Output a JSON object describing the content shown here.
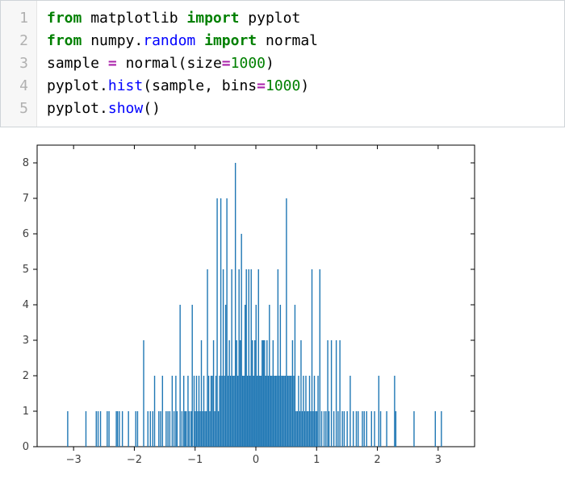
{
  "code": {
    "line_numbers": [
      "1",
      "2",
      "3",
      "4",
      "5"
    ],
    "lines": [
      [
        {
          "cls": "keyword",
          "t": "from"
        },
        {
          "cls": "plain",
          "t": " "
        },
        {
          "cls": "module",
          "t": "matplotlib"
        },
        {
          "cls": "plain",
          "t": " "
        },
        {
          "cls": "keyword",
          "t": "import"
        },
        {
          "cls": "plain",
          "t": " "
        },
        {
          "cls": "module",
          "t": "pyplot"
        }
      ],
      [
        {
          "cls": "keyword",
          "t": "from"
        },
        {
          "cls": "plain",
          "t": " "
        },
        {
          "cls": "module",
          "t": "numpy"
        },
        {
          "cls": "punct",
          "t": "."
        },
        {
          "cls": "func",
          "t": "random"
        },
        {
          "cls": "plain",
          "t": " "
        },
        {
          "cls": "keyword",
          "t": "import"
        },
        {
          "cls": "plain",
          "t": " "
        },
        {
          "cls": "module",
          "t": "normal"
        }
      ],
      [
        {
          "cls": "identifier",
          "t": "sample"
        },
        {
          "cls": "plain",
          "t": " "
        },
        {
          "cls": "operator",
          "t": "="
        },
        {
          "cls": "plain",
          "t": " "
        },
        {
          "cls": "identifier",
          "t": "normal"
        },
        {
          "cls": "punct",
          "t": "("
        },
        {
          "cls": "identifier",
          "t": "size"
        },
        {
          "cls": "operator",
          "t": "="
        },
        {
          "cls": "number",
          "t": "1000"
        },
        {
          "cls": "punct",
          "t": ")"
        }
      ],
      [
        {
          "cls": "identifier",
          "t": "pyplot"
        },
        {
          "cls": "punct",
          "t": "."
        },
        {
          "cls": "func",
          "t": "hist"
        },
        {
          "cls": "punct",
          "t": "("
        },
        {
          "cls": "identifier",
          "t": "sample"
        },
        {
          "cls": "punct",
          "t": ","
        },
        {
          "cls": "plain",
          "t": " "
        },
        {
          "cls": "identifier",
          "t": "bins"
        },
        {
          "cls": "operator",
          "t": "="
        },
        {
          "cls": "number",
          "t": "1000"
        },
        {
          "cls": "punct",
          "t": ")"
        }
      ],
      [
        {
          "cls": "identifier",
          "t": "pyplot"
        },
        {
          "cls": "punct",
          "t": "."
        },
        {
          "cls": "func",
          "t": "show"
        },
        {
          "cls": "punct",
          "t": "()"
        }
      ]
    ]
  },
  "chart_data": {
    "type": "bar",
    "title": "",
    "xlabel": "",
    "ylabel": "",
    "xlim": [
      -3.6,
      3.6
    ],
    "ylim": [
      0,
      8.5
    ],
    "xticks": [
      -3,
      -2,
      -1,
      0,
      1,
      2,
      3
    ],
    "yticks": [
      0,
      1,
      2,
      3,
      4,
      5,
      6,
      7,
      8
    ],
    "xtick_labels": [
      "−3",
      "−2",
      "−1",
      "0",
      "1",
      "2",
      "3"
    ],
    "ytick_labels": [
      "0",
      "1",
      "2",
      "3",
      "4",
      "5",
      "6",
      "7",
      "8"
    ],
    "bar_width": 0.012,
    "bars": [
      {
        "x": -3.1,
        "h": 1
      },
      {
        "x": -2.8,
        "h": 1
      },
      {
        "x": -2.63,
        "h": 1
      },
      {
        "x": -2.6,
        "h": 1
      },
      {
        "x": -2.56,
        "h": 1
      },
      {
        "x": -2.45,
        "h": 1
      },
      {
        "x": -2.42,
        "h": 1
      },
      {
        "x": -2.3,
        "h": 1
      },
      {
        "x": -2.28,
        "h": 1
      },
      {
        "x": -2.25,
        "h": 1
      },
      {
        "x": -2.2,
        "h": 1
      },
      {
        "x": -2.1,
        "h": 1
      },
      {
        "x": -1.98,
        "h": 1
      },
      {
        "x": -1.95,
        "h": 1
      },
      {
        "x": -1.85,
        "h": 3
      },
      {
        "x": -1.78,
        "h": 1
      },
      {
        "x": -1.74,
        "h": 1
      },
      {
        "x": -1.7,
        "h": 1
      },
      {
        "x": -1.67,
        "h": 2
      },
      {
        "x": -1.6,
        "h": 1
      },
      {
        "x": -1.57,
        "h": 1
      },
      {
        "x": -1.54,
        "h": 2
      },
      {
        "x": -1.48,
        "h": 1
      },
      {
        "x": -1.45,
        "h": 1
      },
      {
        "x": -1.42,
        "h": 1
      },
      {
        "x": -1.38,
        "h": 2
      },
      {
        "x": -1.35,
        "h": 1
      },
      {
        "x": -1.32,
        "h": 2
      },
      {
        "x": -1.3,
        "h": 1
      },
      {
        "x": -1.25,
        "h": 4
      },
      {
        "x": -1.22,
        "h": 1
      },
      {
        "x": -1.19,
        "h": 2
      },
      {
        "x": -1.17,
        "h": 1
      },
      {
        "x": -1.15,
        "h": 1
      },
      {
        "x": -1.12,
        "h": 2
      },
      {
        "x": -1.1,
        "h": 1
      },
      {
        "x": -1.07,
        "h": 1
      },
      {
        "x": -1.05,
        "h": 4
      },
      {
        "x": -1.02,
        "h": 2
      },
      {
        "x": -1.0,
        "h": 1
      },
      {
        "x": -0.98,
        "h": 2
      },
      {
        "x": -0.96,
        "h": 1
      },
      {
        "x": -0.94,
        "h": 2
      },
      {
        "x": -0.92,
        "h": 1
      },
      {
        "x": -0.9,
        "h": 3
      },
      {
        "x": -0.88,
        "h": 1
      },
      {
        "x": -0.86,
        "h": 2
      },
      {
        "x": -0.84,
        "h": 1
      },
      {
        "x": -0.82,
        "h": 1
      },
      {
        "x": -0.8,
        "h": 5
      },
      {
        "x": -0.78,
        "h": 2
      },
      {
        "x": -0.76,
        "h": 1
      },
      {
        "x": -0.74,
        "h": 2
      },
      {
        "x": -0.72,
        "h": 2
      },
      {
        "x": -0.7,
        "h": 3
      },
      {
        "x": -0.68,
        "h": 1
      },
      {
        "x": -0.66,
        "h": 2
      },
      {
        "x": -0.64,
        "h": 7
      },
      {
        "x": -0.62,
        "h": 1
      },
      {
        "x": -0.6,
        "h": 2
      },
      {
        "x": -0.58,
        "h": 7
      },
      {
        "x": -0.56,
        "h": 2
      },
      {
        "x": -0.54,
        "h": 5
      },
      {
        "x": -0.52,
        "h": 2
      },
      {
        "x": -0.5,
        "h": 4
      },
      {
        "x": -0.48,
        "h": 7
      },
      {
        "x": -0.46,
        "h": 2
      },
      {
        "x": -0.44,
        "h": 3
      },
      {
        "x": -0.42,
        "h": 2
      },
      {
        "x": -0.4,
        "h": 5
      },
      {
        "x": -0.38,
        "h": 2
      },
      {
        "x": -0.36,
        "h": 2
      },
      {
        "x": -0.34,
        "h": 8
      },
      {
        "x": -0.32,
        "h": 3
      },
      {
        "x": -0.3,
        "h": 2
      },
      {
        "x": -0.28,
        "h": 5
      },
      {
        "x": -0.26,
        "h": 3
      },
      {
        "x": -0.24,
        "h": 6
      },
      {
        "x": -0.22,
        "h": 2
      },
      {
        "x": -0.2,
        "h": 2
      },
      {
        "x": -0.18,
        "h": 4
      },
      {
        "x": -0.16,
        "h": 5
      },
      {
        "x": -0.14,
        "h": 2
      },
      {
        "x": -0.12,
        "h": 5
      },
      {
        "x": -0.1,
        "h": 2
      },
      {
        "x": -0.08,
        "h": 5
      },
      {
        "x": -0.06,
        "h": 3
      },
      {
        "x": -0.04,
        "h": 2
      },
      {
        "x": -0.02,
        "h": 3
      },
      {
        "x": 0.0,
        "h": 4
      },
      {
        "x": 0.02,
        "h": 2
      },
      {
        "x": 0.04,
        "h": 5
      },
      {
        "x": 0.06,
        "h": 2
      },
      {
        "x": 0.08,
        "h": 2
      },
      {
        "x": 0.1,
        "h": 3
      },
      {
        "x": 0.12,
        "h": 3
      },
      {
        "x": 0.14,
        "h": 3
      },
      {
        "x": 0.16,
        "h": 2
      },
      {
        "x": 0.18,
        "h": 3
      },
      {
        "x": 0.2,
        "h": 2
      },
      {
        "x": 0.22,
        "h": 4
      },
      {
        "x": 0.24,
        "h": 2
      },
      {
        "x": 0.26,
        "h": 2
      },
      {
        "x": 0.28,
        "h": 3
      },
      {
        "x": 0.3,
        "h": 2
      },
      {
        "x": 0.32,
        "h": 2
      },
      {
        "x": 0.34,
        "h": 2
      },
      {
        "x": 0.36,
        "h": 5
      },
      {
        "x": 0.38,
        "h": 2
      },
      {
        "x": 0.4,
        "h": 4
      },
      {
        "x": 0.42,
        "h": 2
      },
      {
        "x": 0.44,
        "h": 2
      },
      {
        "x": 0.46,
        "h": 2
      },
      {
        "x": 0.48,
        "h": 2
      },
      {
        "x": 0.5,
        "h": 7
      },
      {
        "x": 0.52,
        "h": 2
      },
      {
        "x": 0.54,
        "h": 2
      },
      {
        "x": 0.56,
        "h": 2
      },
      {
        "x": 0.58,
        "h": 2
      },
      {
        "x": 0.6,
        "h": 3
      },
      {
        "x": 0.62,
        "h": 2
      },
      {
        "x": 0.64,
        "h": 4
      },
      {
        "x": 0.66,
        "h": 1
      },
      {
        "x": 0.68,
        "h": 1
      },
      {
        "x": 0.7,
        "h": 2
      },
      {
        "x": 0.72,
        "h": 1
      },
      {
        "x": 0.74,
        "h": 3
      },
      {
        "x": 0.76,
        "h": 1
      },
      {
        "x": 0.78,
        "h": 2
      },
      {
        "x": 0.8,
        "h": 1
      },
      {
        "x": 0.82,
        "h": 2
      },
      {
        "x": 0.84,
        "h": 1
      },
      {
        "x": 0.86,
        "h": 1
      },
      {
        "x": 0.88,
        "h": 2
      },
      {
        "x": 0.9,
        "h": 1
      },
      {
        "x": 0.92,
        "h": 5
      },
      {
        "x": 0.94,
        "h": 1
      },
      {
        "x": 0.96,
        "h": 2
      },
      {
        "x": 0.98,
        "h": 1
      },
      {
        "x": 1.0,
        "h": 1
      },
      {
        "x": 1.02,
        "h": 2
      },
      {
        "x": 1.05,
        "h": 5
      },
      {
        "x": 1.08,
        "h": 1
      },
      {
        "x": 1.12,
        "h": 1
      },
      {
        "x": 1.15,
        "h": 1
      },
      {
        "x": 1.18,
        "h": 3
      },
      {
        "x": 1.2,
        "h": 1
      },
      {
        "x": 1.24,
        "h": 3
      },
      {
        "x": 1.28,
        "h": 1
      },
      {
        "x": 1.32,
        "h": 3
      },
      {
        "x": 1.35,
        "h": 1
      },
      {
        "x": 1.38,
        "h": 3
      },
      {
        "x": 1.42,
        "h": 1
      },
      {
        "x": 1.45,
        "h": 1
      },
      {
        "x": 1.5,
        "h": 1
      },
      {
        "x": 1.55,
        "h": 2
      },
      {
        "x": 1.6,
        "h": 1
      },
      {
        "x": 1.65,
        "h": 1
      },
      {
        "x": 1.68,
        "h": 1
      },
      {
        "x": 1.75,
        "h": 1
      },
      {
        "x": 1.78,
        "h": 1
      },
      {
        "x": 1.82,
        "h": 1
      },
      {
        "x": 1.9,
        "h": 1
      },
      {
        "x": 1.95,
        "h": 1
      },
      {
        "x": 2.02,
        "h": 2
      },
      {
        "x": 2.05,
        "h": 1
      },
      {
        "x": 2.15,
        "h": 1
      },
      {
        "x": 2.28,
        "h": 2
      },
      {
        "x": 2.3,
        "h": 1
      },
      {
        "x": 2.6,
        "h": 1
      },
      {
        "x": 2.95,
        "h": 1
      },
      {
        "x": 3.05,
        "h": 1
      }
    ],
    "bar_color": "#1f77b4"
  }
}
